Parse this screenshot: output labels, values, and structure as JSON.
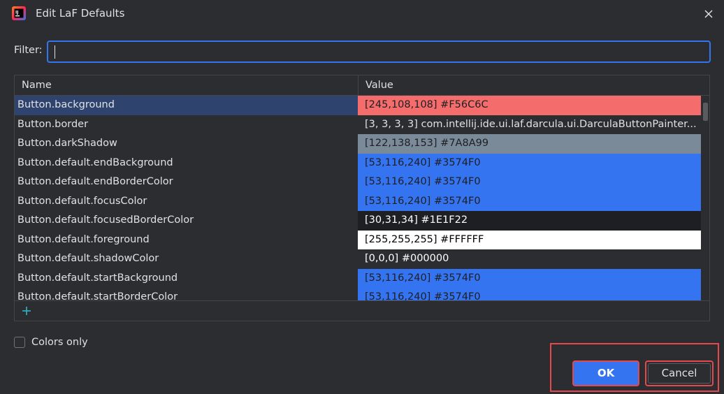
{
  "window": {
    "title": "Edit LaF Defaults",
    "icon": "intellij-idea-icon",
    "close_icon": "close-icon"
  },
  "filter": {
    "label": "Filter:",
    "value": "",
    "placeholder": ""
  },
  "table": {
    "columns": [
      "Name",
      "Value"
    ],
    "rows": [
      {
        "name": "Button.background",
        "value": "[245,108,108] #F56C6C",
        "swatch": "#F56C6C",
        "text_color": "#1e1f22",
        "selected": true
      },
      {
        "name": "Button.border",
        "value": "[3, 3, 3, 3] com.intellij.ide.ui.laf.darcula.ui.DarculaButtonPainter...",
        "swatch": "",
        "text_color": "#dfe1e5",
        "selected": false
      },
      {
        "name": "Button.darkShadow",
        "value": "[122,138,153] #7A8A99",
        "swatch": "#7A8A99",
        "text_color": "#1e1f22",
        "selected": false
      },
      {
        "name": "Button.default.endBackground",
        "value": "[53,116,240] #3574F0",
        "swatch": "#3574F0",
        "text_color": "#1e1f22",
        "selected": false
      },
      {
        "name": "Button.default.endBorderColor",
        "value": "[53,116,240] #3574F0",
        "swatch": "#3574F0",
        "text_color": "#1e1f22",
        "selected": false
      },
      {
        "name": "Button.default.focusColor",
        "value": "[53,116,240] #3574F0",
        "swatch": "#3574F0",
        "text_color": "#1e1f22",
        "selected": false
      },
      {
        "name": "Button.default.focusedBorderColor",
        "value": "[30,31,34] #1E1F22",
        "swatch": "#1E1F22",
        "text_color": "#ffffff",
        "selected": false
      },
      {
        "name": "Button.default.foreground",
        "value": "[255,255,255] #FFFFFF",
        "swatch": "#FFFFFF",
        "text_color": "#000000",
        "selected": false
      },
      {
        "name": "Button.default.shadowColor",
        "value": "[0,0,0] #000000",
        "swatch": "#2b2d30",
        "text_color": "#ffffff",
        "selected": false
      },
      {
        "name": "Button.default.startBackground",
        "value": "[53,116,240] #3574F0",
        "swatch": "#3574F0",
        "text_color": "#1e1f22",
        "selected": false
      },
      {
        "name": "Button.default.startBorderColor",
        "value": "[53,116,240] #3574F0",
        "swatch": "#3574F0",
        "text_color": "#1e1f22",
        "selected": false
      }
    ],
    "add_icon": "plus-icon"
  },
  "colors_only": {
    "label": "Colors only",
    "checked": false
  },
  "buttons": {
    "ok": "OK",
    "cancel": "Cancel"
  },
  "colors": {
    "background": "#2b2d30",
    "accent": "#3574f0",
    "highlight": "#e5484d",
    "selection": "#2e436e"
  }
}
